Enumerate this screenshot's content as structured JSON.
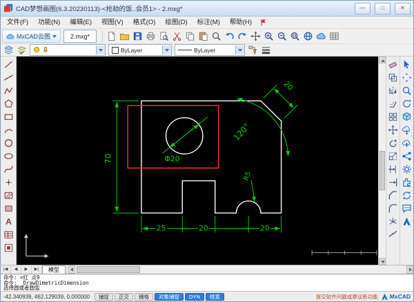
{
  "window": {
    "title": "CAD梦想画图(6.3.20230113)-<抢劫的饭..会员1> - 2.mxg*",
    "controls": {
      "minimize": "—",
      "maximize": "□",
      "close": "✕"
    }
  },
  "menu": {
    "items": [
      "文件(F)",
      "功能(N)",
      "编辑(E)",
      "视图(V)",
      "格式(O)",
      "绘图(D)",
      "标注(M)",
      "帮助(H)"
    ]
  },
  "doc_toolbar": {
    "cloud_button": "MxCAD云图",
    "active_tab": "2.mxg*",
    "icons": [
      "new-file",
      "open-folder",
      "save",
      "plot",
      "print-preview",
      "cut",
      "copy",
      "paste",
      "find",
      "undo",
      "redo",
      "pan",
      "zoom-in",
      "zoom-out",
      "zoom-extents",
      "globe",
      "web-cloud",
      "grid-table"
    ]
  },
  "properties_toolbar": {
    "left_icons": [
      "layer-properties",
      "layer-states"
    ],
    "color_value": "ByLayer",
    "linetype_value": "ByLayer",
    "right_icons": [
      "match-properties",
      "lineweight"
    ]
  },
  "left_palette": {
    "icons": [
      "line",
      "construction-line",
      "polyline",
      "polygon",
      "rectangle",
      "arc",
      "circle",
      "ellipse",
      "spline",
      "point",
      "hatch",
      "region",
      "text",
      "table",
      "block"
    ]
  },
  "right_palette_modify": {
    "icons": [
      "erase",
      "copy-object",
      "mirror",
      "offset",
      "array",
      "move",
      "rotate",
      "scale",
      "trim",
      "extend",
      "chamfer",
      "fillet",
      "explode",
      "join"
    ]
  },
  "right_palette_view": {
    "icons": [
      "select-tool",
      "pan-view",
      "zoom-view",
      "view-rotate",
      "cube-3d",
      "cloud-save",
      "cloud-open",
      "share",
      "settings-gear",
      "plugin",
      "update",
      "feedback",
      "mxcad-badge"
    ]
  },
  "drawing": {
    "dim_height": "70",
    "dim_bottom": [
      "25",
      "20",
      "20"
    ],
    "dim_chamfer": "20",
    "dim_angle": "120°",
    "dim_radius": "R5",
    "dim_diameter": "Φ20",
    "colors": {
      "outline": "#ffffff",
      "dimension": "#00cc00",
      "selection": "#ff2a2a",
      "background": "#000000"
    }
  },
  "model_tabs": {
    "nav": [
      "|◀",
      "◀",
      "▶",
      "▶|"
    ],
    "tab": "模型"
  },
  "command": {
    "lines": [
      "命令: <红 点9",
      "命令: _DrawDimetricDimension",
      "选择圆或者圆弧"
    ]
  },
  "status": {
    "coordinates": "-42.340939, 462.129039, 0.000000",
    "toggles": [
      {
        "label": "捕捉",
        "active": false
      },
      {
        "label": "正交",
        "active": false
      },
      {
        "label": "栅格",
        "active": false
      },
      {
        "label": "对象捕捉",
        "active": true
      },
      {
        "label": "DYN",
        "active": true
      },
      {
        "label": "线宽",
        "active": true
      }
    ],
    "feedback": "提交软件问题或建议新功能",
    "brand": "MxCAD"
  }
}
